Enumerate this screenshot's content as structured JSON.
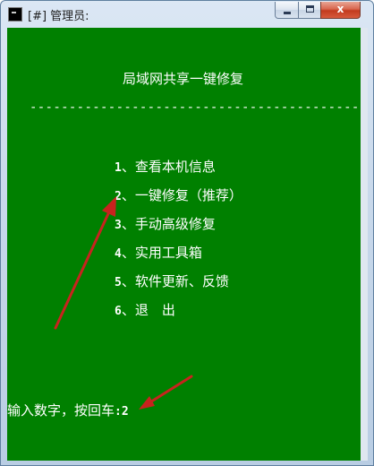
{
  "window": {
    "title": "[#] 管理员:",
    "minimize_icon": "minimize-icon",
    "maximize_icon": "maximize-icon",
    "close_label": "x"
  },
  "console": {
    "header": "局域网共享一键修复",
    "divider": "--------------------------------------------------------",
    "menu": [
      {
        "number": "1",
        "label": "、查看本机信息"
      },
      {
        "number": "2",
        "label": "、一键修复（推荐）"
      },
      {
        "number": "3",
        "label": "、手动高级修复"
      },
      {
        "number": "4",
        "label": "、实用工具箱"
      },
      {
        "number": "5",
        "label": "、软件更新、反馈"
      },
      {
        "number": "6",
        "label": "、退　出"
      }
    ],
    "prompt_label": "输入数字，按回车",
    "prompt_value": ":2"
  },
  "colors": {
    "console_background": "#008000",
    "console_text": "#ffffff",
    "annotation_arrow": "#c8231e"
  }
}
